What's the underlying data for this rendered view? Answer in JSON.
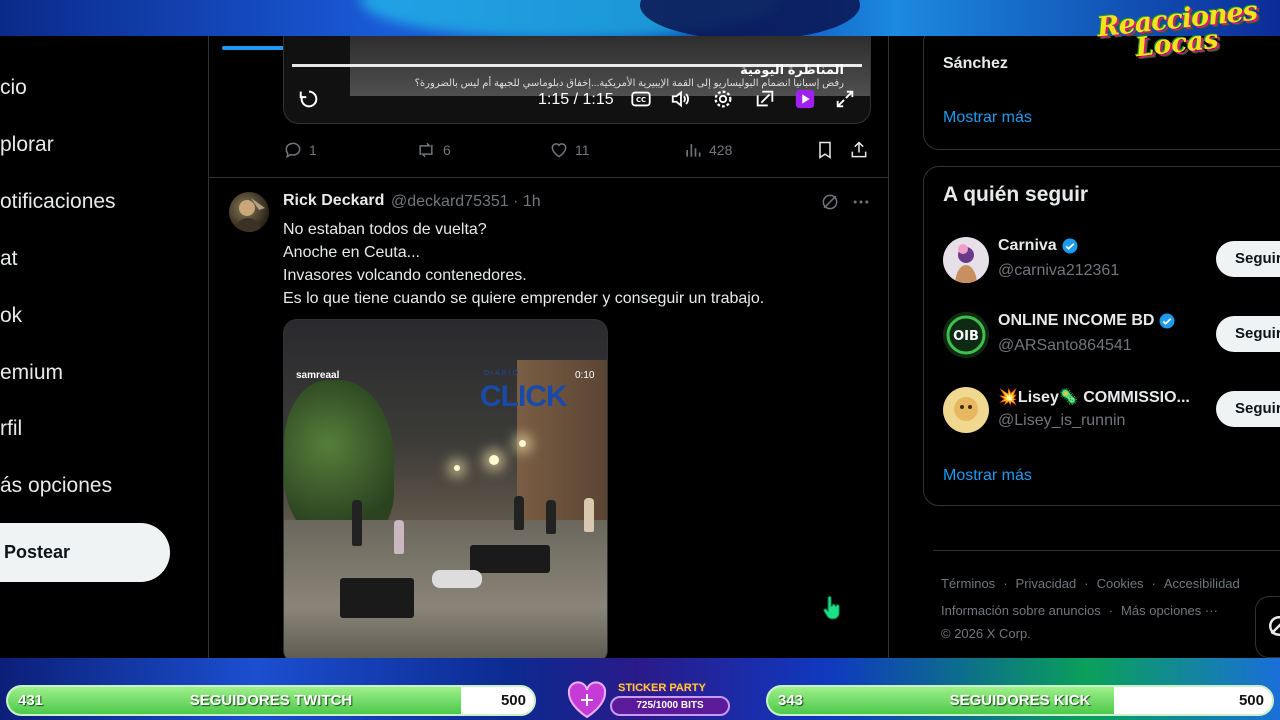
{
  "stream": {
    "logo_line1": "Reacciones",
    "logo_line2": "Locas",
    "twitch_goal": {
      "current": "431",
      "label": "SEGUIDORES TWITCH",
      "max": "500",
      "progress": 0.862
    },
    "kick_goal": {
      "current": "343",
      "label": "SEGUIDORES KICK",
      "max": "500",
      "progress": 0.686
    },
    "sticker_party": {
      "title": "STICKER PARTY",
      "value": "725/1000 BITS",
      "progress": 0.725
    }
  },
  "nav": {
    "items": [
      {
        "label": "cio"
      },
      {
        "label": "plorar"
      },
      {
        "label": "otificaciones"
      },
      {
        "label": "at"
      },
      {
        "label": "ok"
      },
      {
        "label": "emium"
      },
      {
        "label": "rfil"
      },
      {
        "label": "ás opciones"
      }
    ],
    "post_label": "Postear"
  },
  "previous_tweet": {
    "video": {
      "title_ar": "المناظرة اليومية",
      "subtitle_ar": "رفض إسبانيا انضمام البوليساريو إلى القمة الإيبيرية الأمريكية...إخفاق دبلوماسي للجبهة أم ليس بالضرورة؟",
      "time": "1:15 / 1:15"
    },
    "stats": {
      "replies": "1",
      "reposts": "6",
      "likes": "11",
      "views": "428"
    }
  },
  "tweet": {
    "name": "Rick Deckard",
    "handle": "@deckard75351 · 1h",
    "lines": [
      "No estaban todos de vuelta?",
      "Anoche en Ceuta...",
      "Invasores volcando contenedores.",
      "Es lo que tiene cuando se quiere emprender y conseguir un trabajo."
    ],
    "media": {
      "watermark": "samreaal",
      "brand_small": "DIARIO",
      "brand": "CLICK",
      "time": "0:10"
    }
  },
  "right": {
    "trend_name": "Sánchez",
    "show_more": "Mostrar más",
    "who_to_follow_title": "A quién seguir",
    "follow_button": "Seguir",
    "suggestions": [
      {
        "name": "Carniva",
        "handle": "@carniva212361",
        "verified": true
      },
      {
        "name": "ONLINE INCOME BD",
        "handle": "@ARSanto864541",
        "verified": true
      },
      {
        "name": "💥Lisey🦠 COMMISSIO...",
        "handle": "@Lisey_is_runnin",
        "verified": false
      }
    ],
    "show_more_2": "Mostrar más",
    "footer": {
      "links_row1": [
        "Términos",
        "Privacidad",
        "Cookies",
        "Accesibilidad"
      ],
      "links_row2": [
        "Información sobre anuncios",
        "Más opciones ···"
      ],
      "copyright": "© 2026 X Corp."
    }
  },
  "colors": {
    "accent": "#1d9bf0",
    "text": "#e7e9ea",
    "muted": "#71767b",
    "border": "#2f3336"
  }
}
